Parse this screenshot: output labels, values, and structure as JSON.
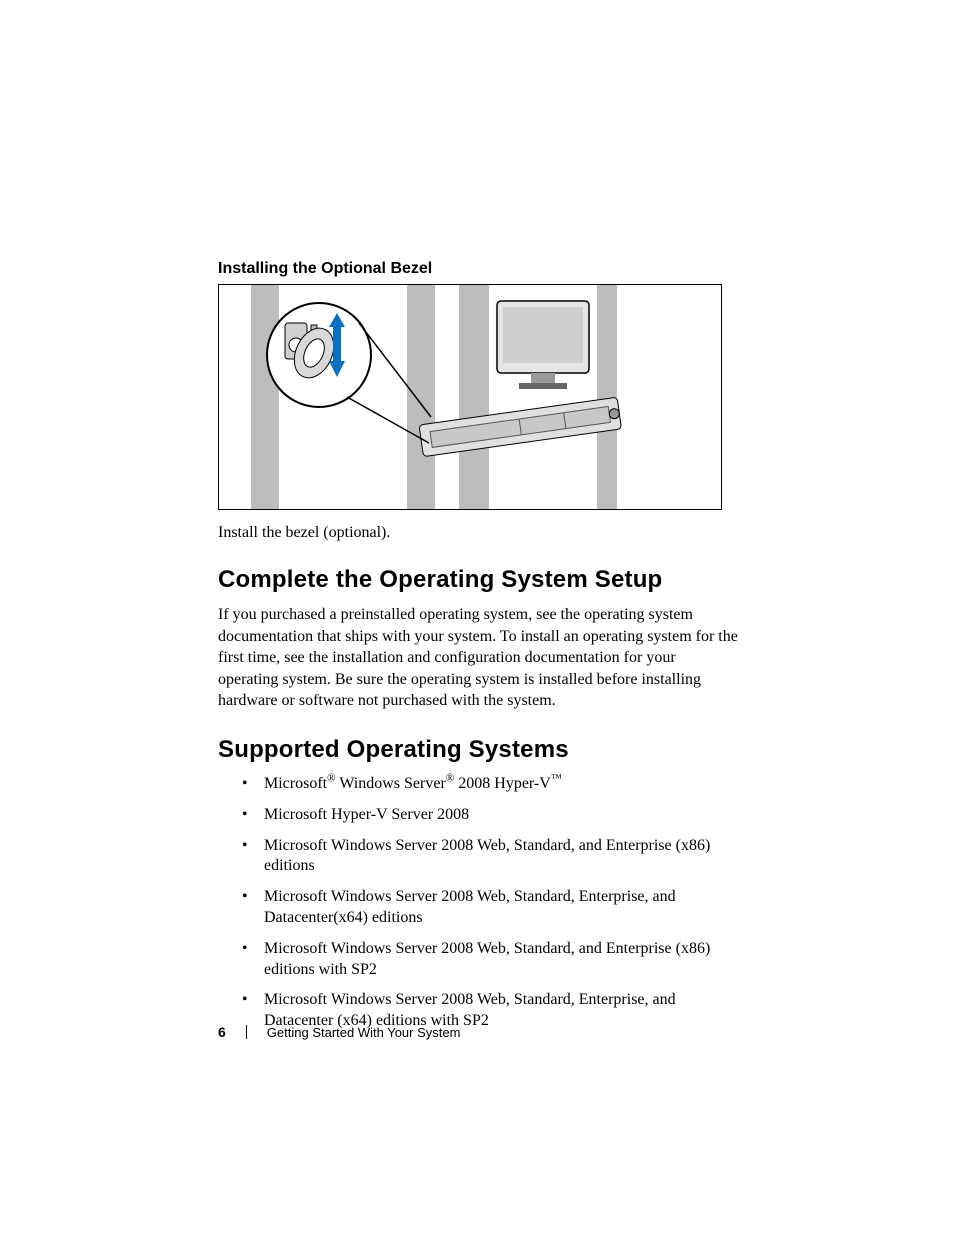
{
  "subhead": "Installing the Optional Bezel",
  "caption": "Install the bezel (optional).",
  "section1_title": "Complete the Operating System Setup",
  "section1_body": "If you purchased a preinstalled operating system, see the operating system documentation that ships with your system. To install an operating system for the first time, see the installation and configuration documentation for your operating system. Be sure the operating system is installed before installing hardware or software not purchased with the system.",
  "section2_title": "Supported Operating Systems",
  "os_list": [
    {
      "segments": [
        {
          "text": "Microsoft",
          "sup": "®"
        },
        {
          "text": " Windows Server",
          "sup": "®"
        },
        {
          "text": " 2008 Hyper-V",
          "sup": "™"
        }
      ]
    },
    {
      "plain": "Microsoft Hyper-V Server 2008"
    },
    {
      "plain": "Microsoft Windows Server 2008 Web, Standard, and Enterprise (x86) editions"
    },
    {
      "plain": "Microsoft Windows Server 2008 Web, Standard, Enterprise, and Datacenter(x64) editions"
    },
    {
      "plain": "Microsoft Windows Server 2008 Web, Standard, and Enterprise (x86) editions with SP2"
    },
    {
      "plain": "Microsoft Windows Server 2008 Web, Standard, Enterprise, and Datacenter (x64) editions with SP2"
    }
  ],
  "footer": {
    "page": "6",
    "title": "Getting Started With Your System"
  }
}
